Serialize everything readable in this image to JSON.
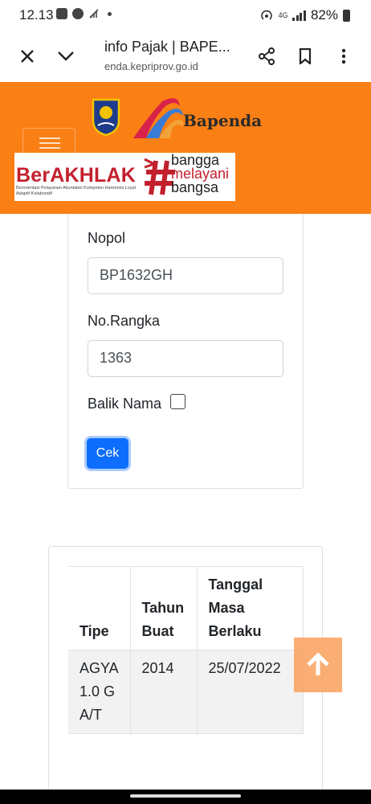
{
  "status_bar": {
    "time": "12.13",
    "network": "4G",
    "battery": "82%",
    "icons": [
      "briefcase-icon",
      "app-icon",
      "signal-crossed-icon",
      "dot-icon",
      "hotspot-icon",
      "cellular-signal-icon",
      "battery-icon"
    ]
  },
  "browser": {
    "page_title": "info Pajak | BAPE...",
    "url": "enda.kepriprov.go.id",
    "close_icon": "close-icon",
    "dropdown_icon": "chevron-down-icon",
    "share_icon": "share-icon",
    "bookmark_icon": "bookmark-icon",
    "menu_icon": "more-vert-icon"
  },
  "header": {
    "logo_text": "Bapenda",
    "banner": {
      "title": "BerAKHLAK",
      "subtitle": "Berorientasi Pelayanan Akuntabel Kompeten Harmonis Loyal Adaptif Kolaboratif",
      "motto": [
        "bangga",
        "melayani",
        "bangsa"
      ]
    },
    "colors": {
      "accent": "#fa7f15",
      "banner_red": "#c3202d"
    }
  },
  "form": {
    "nopol_label": "Nopol",
    "nopol_value": "BP1632GH",
    "rangka_label": "No.Rangka",
    "rangka_value": "1363",
    "balik_nama_label": "Balik Nama",
    "balik_nama_checked": false,
    "submit_label": "Cek",
    "submit_color": "#0d6efd"
  },
  "result_table": {
    "headers": [
      "Tipe",
      "Tahun Buat",
      "Tanggal Masa Berlaku"
    ],
    "rows": [
      [
        "AGYA 1.0 G A/T",
        "2014",
        "25/07/2022"
      ]
    ]
  },
  "scroll_top_icon": "arrow-up-icon"
}
